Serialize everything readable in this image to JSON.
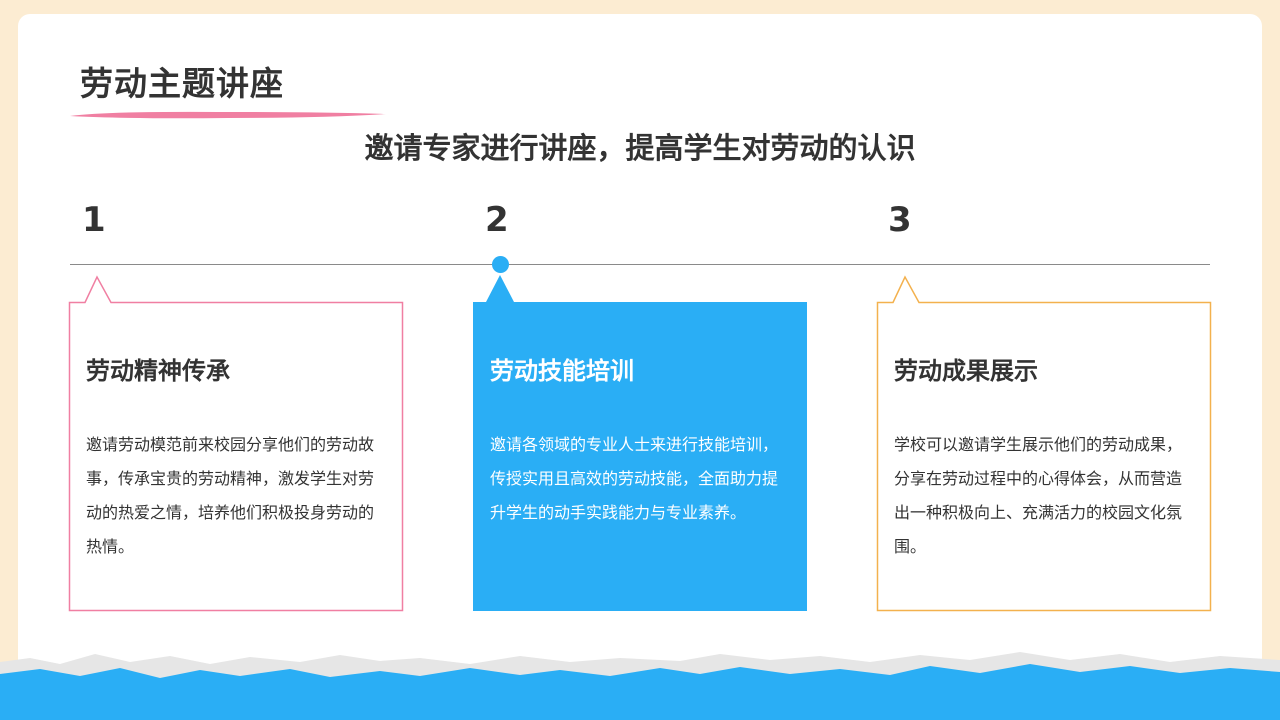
{
  "slide": {
    "title": "劳动主题讲座",
    "subtitle": "邀请专家进行讲座，提高学生对劳动的认识"
  },
  "steps": [
    {
      "number": "1",
      "heading": "劳动精神传承",
      "text": "邀请劳动模范前来校园分享他们的劳动故事，传承宝贵的劳动精神，激发学生对劳动的热爱之情，培养他们积极投身劳动的热情。"
    },
    {
      "number": "2",
      "heading": "劳动技能培训",
      "text": "邀请各领域的专业人士来进行技能培训，传授实用且高效的劳动技能，全面助力提升学生的动手实践能力与专业素养。"
    },
    {
      "number": "3",
      "heading": "劳动成果展示",
      "text": "学校可以邀请学生展示他们的劳动成果，分享在劳动过程中的心得体会，从而营造出一种积极向上、充满活力的校园文化氛围。"
    }
  ],
  "colors": {
    "background": "#fcecd2",
    "card": "#ffffff",
    "pink_accent": "#f07fa2",
    "blue_accent": "#2aaef5",
    "orange_accent": "#f3b14e",
    "text": "#333333"
  }
}
